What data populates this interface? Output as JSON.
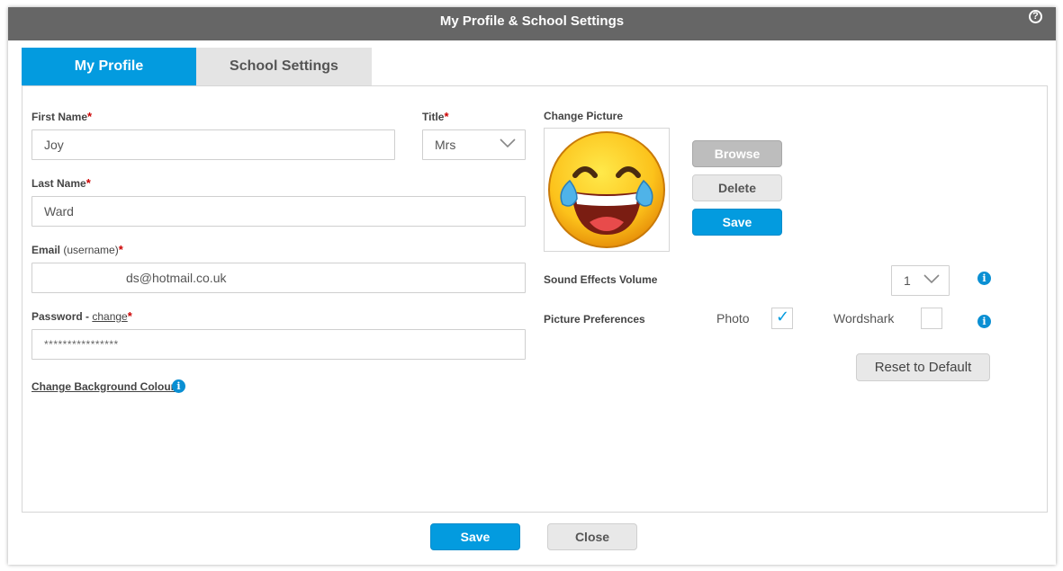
{
  "dialog": {
    "title": "My Profile & School Settings",
    "help_icon": "?"
  },
  "tabs": [
    {
      "label": "My Profile",
      "active": true
    },
    {
      "label": "School Settings",
      "active": false
    }
  ],
  "profile": {
    "first_name": {
      "label": "First Name",
      "required": "*",
      "value": "Joy"
    },
    "title": {
      "label": "Title",
      "required": "*",
      "value": "Mrs"
    },
    "last_name": {
      "label": "Last Name",
      "required": "*",
      "value": "Ward"
    },
    "email": {
      "label": "Email",
      "sub": "(username)",
      "required": "*",
      "value": "ds@hotmail.co.uk"
    },
    "password": {
      "label": "Password - ",
      "link": "change",
      "required": "*",
      "value": "****************"
    },
    "background_link": "Change Background Colour"
  },
  "picture": {
    "label": "Change Picture",
    "browse": "Browse",
    "delete": "Delete",
    "save": "Save"
  },
  "settings": {
    "sound_label": "Sound Effects Volume",
    "sound_value": "1",
    "pref_label": "Picture Preferences",
    "photo_label": "Photo",
    "photo_checked": true,
    "photo_check_glyph": "✓",
    "wordshark_label": "Wordshark",
    "wordshark_checked": false,
    "reset": "Reset to Default"
  },
  "footer": {
    "save": "Save",
    "close": "Close"
  },
  "icons": {
    "info": "i"
  },
  "colors": {
    "accent": "#039bdf",
    "titlebar": "#666666"
  }
}
